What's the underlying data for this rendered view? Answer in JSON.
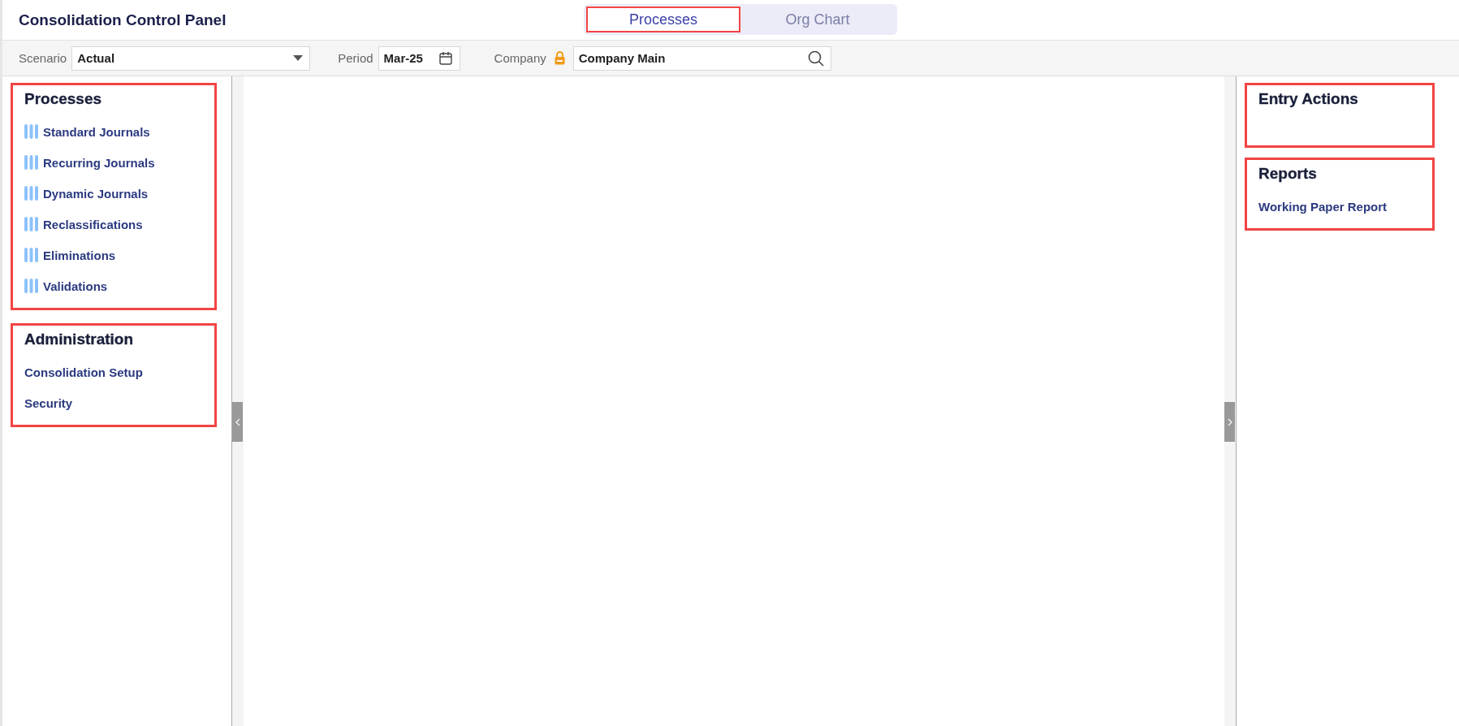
{
  "window": {
    "title": "Consolidation Control Panel"
  },
  "tabs": [
    {
      "label": "Processes",
      "selected": true,
      "highlighted": true
    },
    {
      "label": "Org Chart",
      "selected": false,
      "highlighted": false
    }
  ],
  "filters": {
    "scenario": {
      "label": "Scenario",
      "value": "Actual"
    },
    "period": {
      "label": "Period",
      "value": "Mar-25"
    },
    "company": {
      "label": "Company",
      "locked": true,
      "value": "Company Main"
    }
  },
  "left_panel": [
    {
      "title": "Processes",
      "highlighted": true,
      "items": [
        {
          "label": "Standard Journals",
          "kind": "process"
        },
        {
          "label": "Recurring Journals",
          "kind": "process"
        },
        {
          "label": "Dynamic Journals",
          "kind": "process"
        },
        {
          "label": "Reclassifications",
          "kind": "process"
        },
        {
          "label": "Eliminations",
          "kind": "process"
        },
        {
          "label": "Validations",
          "kind": "process"
        }
      ]
    },
    {
      "title": "Administration",
      "highlighted": true,
      "items": [
        {
          "label": "Consolidation Setup",
          "kind": "link"
        },
        {
          "label": "Security",
          "kind": "link"
        }
      ]
    }
  ],
  "right_panel": [
    {
      "title": "Entry Actions",
      "highlighted": true
    },
    {
      "title": "Reports",
      "highlighted": true,
      "items": [
        {
          "label": "Working Paper Report",
          "kind": "link"
        }
      ]
    }
  ]
}
